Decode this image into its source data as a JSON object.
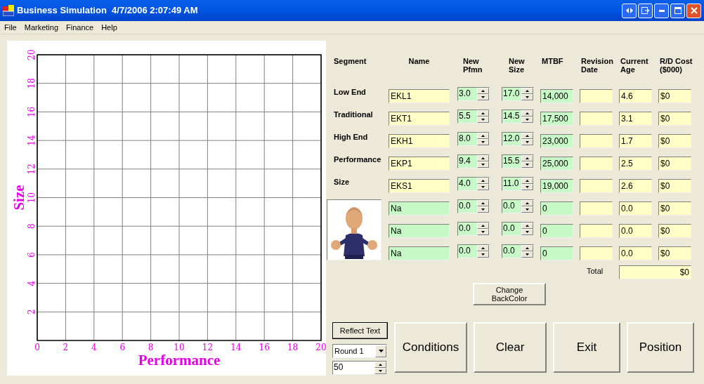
{
  "window": {
    "title": "Business Simulation  4/7/2006 2:07:49 AM"
  },
  "menu": [
    "File",
    "Marketing",
    "Finance",
    "Help"
  ],
  "chart": {
    "chart_data": {
      "type": "scatter",
      "xlabel": "Performance",
      "ylabel": "Size",
      "xlim": [
        0,
        20
      ],
      "ylim": [
        0,
        20
      ],
      "xticks": [
        0,
        2,
        4,
        6,
        8,
        10,
        12,
        14,
        16,
        18,
        20
      ],
      "yticks": [
        2,
        4,
        6,
        8,
        10,
        12,
        14,
        16,
        18,
        20
      ],
      "grid": true
    }
  },
  "products": {
    "columns": [
      "Segment",
      "Name",
      "New Pfmn",
      "New Size",
      "MTBF",
      "Revision Date",
      "Current Age",
      "R/D Cost ($000)"
    ],
    "rows": [
      {
        "segment": "Low End",
        "name": "EKL1",
        "color": "#ffffc8",
        "pfmn": "3.0",
        "size": "17.0",
        "mtbf": "14,000",
        "age": "4.6",
        "rd_cost": "$0"
      },
      {
        "segment": "Traditional",
        "name": "EKT1",
        "color": "#ffffc8",
        "pfmn": "5.5",
        "size": "14.5",
        "mtbf": "17,500",
        "age": "3.1",
        "rd_cost": "$0"
      },
      {
        "segment": "High End",
        "name": "EKH1",
        "color": "#ffffc8",
        "pfmn": "8.0",
        "size": "12.0",
        "mtbf": "23,000",
        "age": "1.7",
        "rd_cost": "$0"
      },
      {
        "segment": "Performance",
        "name": "EKP1",
        "color": "#ffffc8",
        "pfmn": "9.4",
        "size": "15.5",
        "mtbf": "25,000",
        "age": "2.5",
        "rd_cost": "$0"
      },
      {
        "segment": "Size",
        "name": "EKS1",
        "color": "#ffffc8",
        "pfmn": "4.0",
        "size": "11.0",
        "mtbf": "19,000",
        "age": "2.6",
        "rd_cost": "$0"
      },
      {
        "name": "Na",
        "color": "#c8f8c8",
        "pfmn": "0.0",
        "size": "0.0",
        "mtbf": "0",
        "age": "0.0",
        "rd_cost": "$0"
      },
      {
        "name": "Na",
        "color": "#c8f8c8",
        "pfmn": "0.0",
        "size": "0.0",
        "mtbf": "0",
        "age": "0.0",
        "rd_cost": "$0"
      },
      {
        "name": "Na",
        "color": "#c8f8c8",
        "pfmn": "0.0",
        "size": "0.0",
        "mtbf": "0",
        "age": "0.0",
        "rd_cost": "$0"
      }
    ]
  },
  "total": {
    "label": "Total",
    "value": "$0"
  },
  "change_backcolor_button": "Change BackColor",
  "reflect_text_button": "Reflect Text",
  "round_dropdown": {
    "value": "Round 1"
  },
  "amount_spinner": {
    "value": "50"
  },
  "buttons": [
    "Conditions",
    "Clear",
    "Exit",
    "Position"
  ]
}
